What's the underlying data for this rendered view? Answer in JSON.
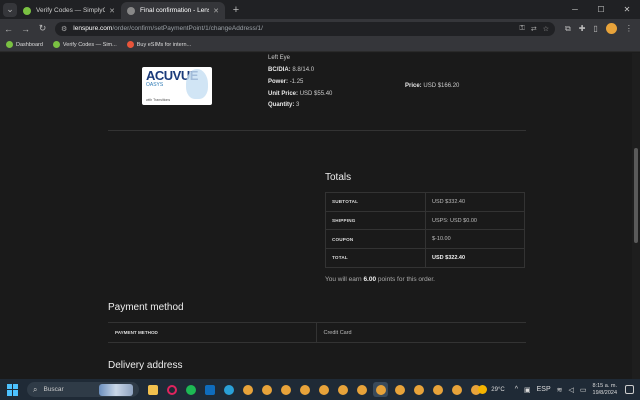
{
  "browser": {
    "tabs": [
      {
        "title": "Verify Codes — SimplyCodes",
        "favicon_color": "#7ac142",
        "active": false
      },
      {
        "title": "Final confirmation - LensPure",
        "favicon_color": "#888888",
        "active": true
      }
    ],
    "url_host": "lenspure.com",
    "url_path": "/order/confirm/setPaymentPoint/1/changeAddress/1/",
    "bookmarks": [
      {
        "label": "Dashboard",
        "icon_color": "#7ac142"
      },
      {
        "label": "Verify Codes — Sim...",
        "icon_color": "#7ac142"
      },
      {
        "label": "Buy eSIMs for intern...",
        "icon_color": "#e8553a"
      }
    ]
  },
  "product": {
    "image": {
      "brand": "ACUVUE",
      "line": "OASYS",
      "sub": "with Transitions"
    },
    "eye_label": "Left Eye",
    "bc_label": "BC/DIA:",
    "bc_value": "8.8/14.0",
    "power_label": "Power:",
    "power_value": "-1.25",
    "unit_price_label": "Unit Price:",
    "unit_price_value": "USD $55.40",
    "quantity_label": "Quantity:",
    "quantity_value": "3",
    "price_label": "Price:",
    "price_value": "USD $166.20"
  },
  "totals": {
    "title": "Totals",
    "rows": [
      {
        "label": "Subtotal",
        "value": "USD $332.40",
        "strong": false
      },
      {
        "label": "Shipping",
        "value": "USPS: USD $0.00",
        "strong": false
      },
      {
        "label": "Coupon",
        "value": "$-10.00",
        "strong": false
      },
      {
        "label": "Total",
        "value": "USD $322.40",
        "strong": true
      }
    ],
    "points_prefix": "You will earn",
    "points_value": "6.00",
    "points_suffix": "points for this order."
  },
  "payment": {
    "title": "Payment method",
    "label": "Payment Method",
    "value": "Credit Card"
  },
  "delivery": {
    "title": "Delivery address"
  },
  "taskbar": {
    "search_placeholder": "Buscar",
    "temperature": "29°C",
    "language": "ESP",
    "time": "8:15 a. m.",
    "date": "19/8/2024"
  }
}
